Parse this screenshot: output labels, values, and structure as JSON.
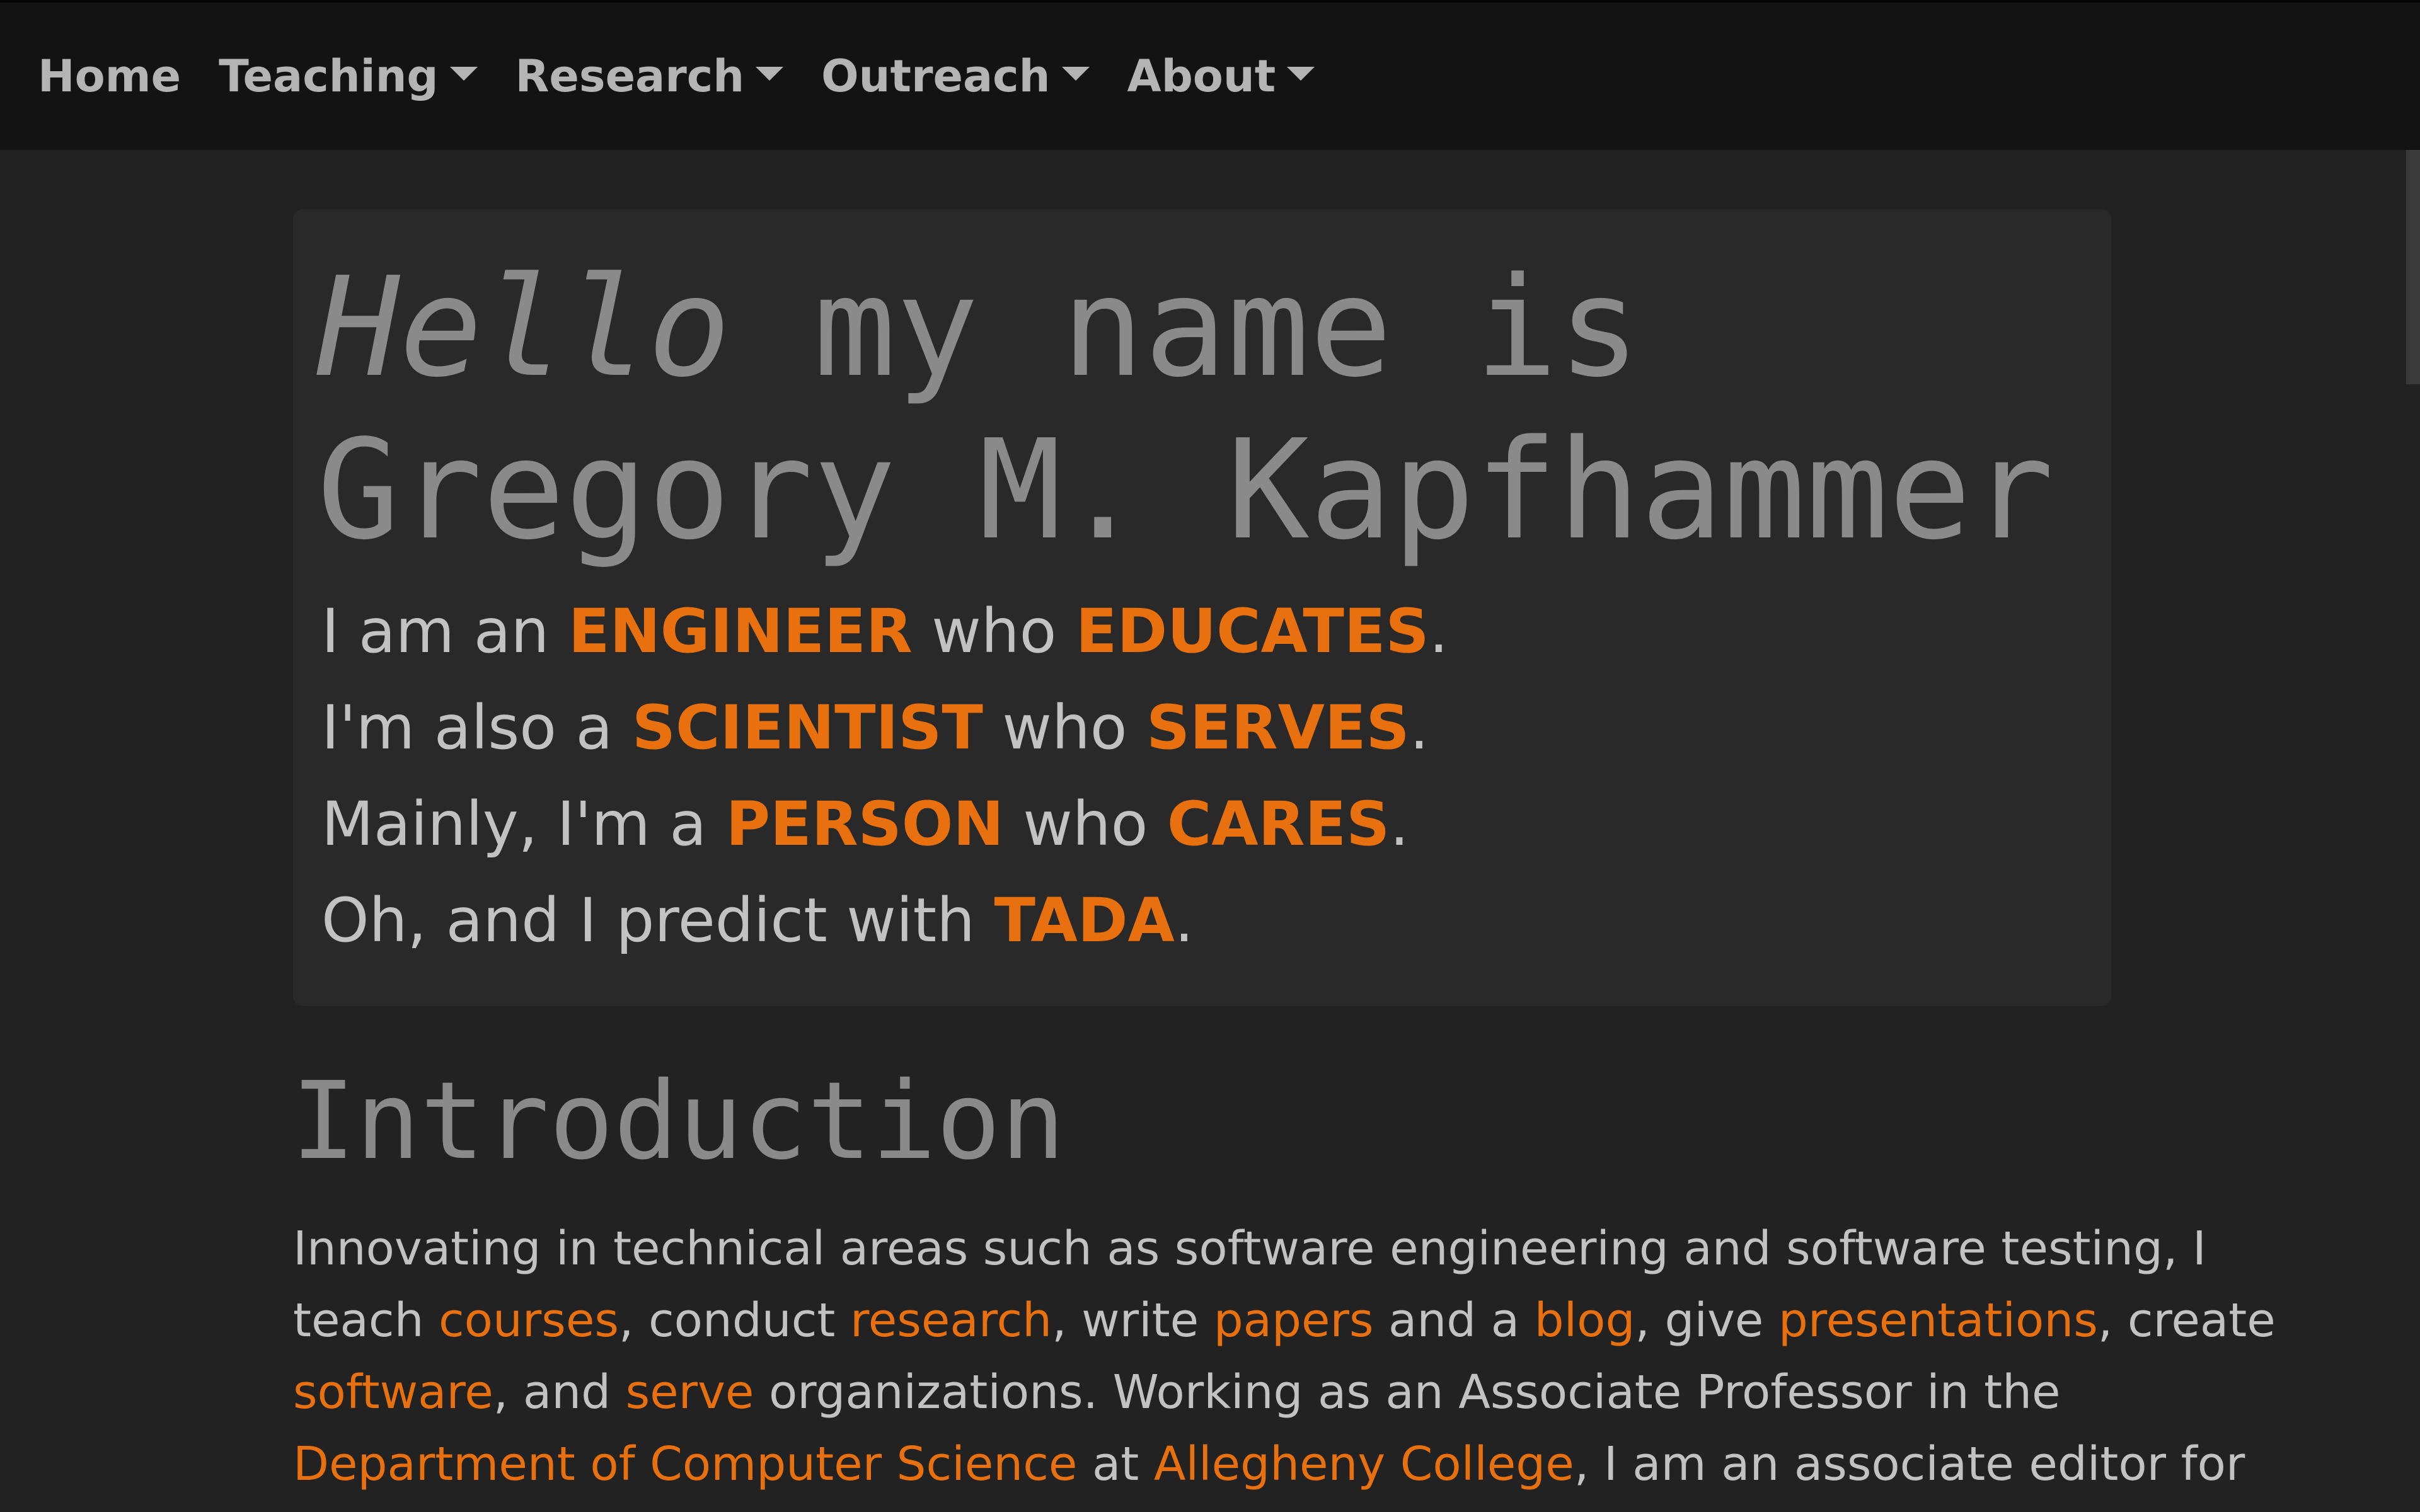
{
  "navbar": {
    "items": [
      {
        "label": "Home",
        "dropdown": false
      },
      {
        "label": "Teaching",
        "dropdown": true
      },
      {
        "label": "Research",
        "dropdown": true
      },
      {
        "label": "Outreach",
        "dropdown": true
      },
      {
        "label": "About",
        "dropdown": true
      }
    ]
  },
  "hero": {
    "greeting": "Hello",
    "name_intro": " my name is",
    "name": "Gregory M. Kapfhammer",
    "lines": [
      {
        "prefix": "I am an ",
        "word1": "ENGINEER",
        "middle": " who ",
        "word2": "EDUCATES",
        "suffix": "."
      },
      {
        "prefix": "I'm also a ",
        "word1": "SCIENTIST",
        "middle": " who ",
        "word2": "SERVES",
        "suffix": "."
      },
      {
        "prefix": "Mainly, I'm a ",
        "word1": "PERSON",
        "middle": " who ",
        "word2": "CARES",
        "suffix": "."
      }
    ],
    "last_line": {
      "prefix": "Oh, and I predict with ",
      "word": "TADA",
      "suffix": "."
    }
  },
  "intro": {
    "heading": "Introduction",
    "line1": "Innovating in technical areas such as software engineering and software testing, I",
    "l2_t1": "teach ",
    "l2_link1": "courses",
    "l2_t2": ", conduct ",
    "l2_link2": "research",
    "l2_t3": ", write ",
    "l2_link3": "papers",
    "l2_t4": " and a ",
    "l2_link4": "blog",
    "l2_t5": ", give ",
    "l2_link5": "presentations",
    "l2_t6": ", create",
    "l3_link1": "software",
    "l3_t1": ", and ",
    "l3_link2": "serve",
    "l3_t2": " organizations. Working as an Associate Professor in the",
    "l4_link1": "Department of Computer Science",
    "l4_t1": " at ",
    "l4_link2": "Allegheny College",
    "l4_t2": ", I am an associate editor for"
  },
  "colors": {
    "accent": "#e8700f",
    "background": "#222222",
    "navbar": "#131313",
    "panel": "#292929"
  }
}
